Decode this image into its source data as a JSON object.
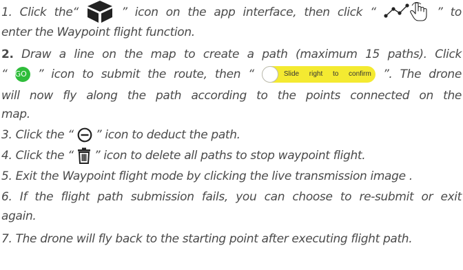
{
  "instructions": {
    "step1": {
      "part_a": "1. Click the“",
      "part_b": "” icon on the app interface, then click “",
      "part_c": "” to",
      "cont": "enter the Waypoint flight function."
    },
    "step2": {
      "number": "2.",
      "part_a": "Draw a line on the map to create a path (maximum 15 paths). Click",
      "part_b": "“",
      "go_label": "GO",
      "part_c": "” icon to submit the route, then “",
      "slider_label": "Slide right to confirm",
      "part_d": "”. The drone",
      "cont1": "will now fly along the path according to the points connected on the",
      "cont2": "map."
    },
    "step3": {
      "part_a": "3. Click the “",
      "part_b": "” icon to deduct the path."
    },
    "step4": {
      "part_a": "4. Click the “",
      "part_b": "” icon to delete all paths to stop waypoint flight."
    },
    "step5": "5. Exit the Waypoint flight mode by clicking the live transmission image .",
    "step6": {
      "line1": "6. If the flight path submission fails, you can choose to re-submit or exit",
      "line2": "again."
    },
    "step7": "7. The drone will fly back to the starting point after executing flight path."
  },
  "icons": {
    "app_icon": "cube-icon",
    "waypoint": "waypoint-icon",
    "go": "go-icon",
    "confirm_slider": "slide-confirm-icon",
    "deduct": "minus-circle-icon",
    "delete": "trash-icon"
  },
  "colors": {
    "text": "#4a4a4a",
    "go_green": "#2fbd3b",
    "slider_yellow": "#f4ea31",
    "icon_dark": "#222222"
  }
}
